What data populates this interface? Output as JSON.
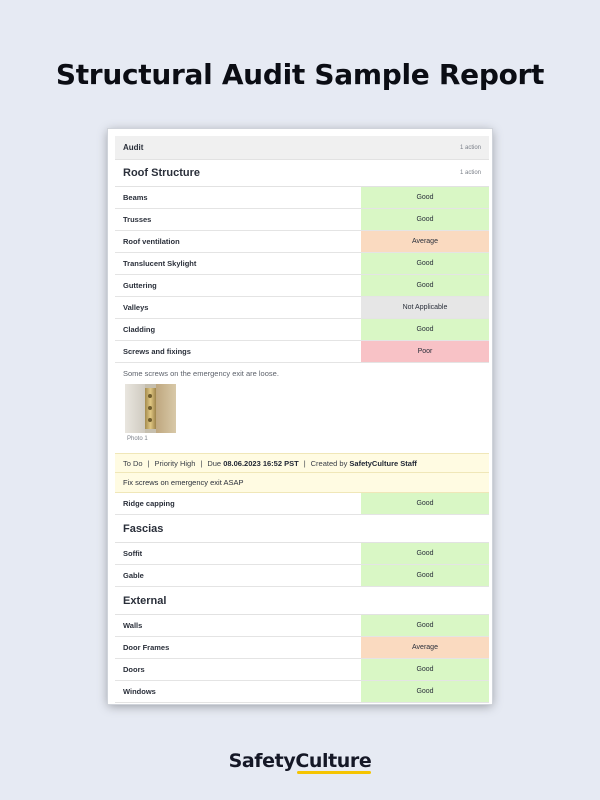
{
  "page": {
    "title": "Structural Audit Sample Report"
  },
  "report": {
    "audit": {
      "label": "Audit",
      "count": "1 action"
    },
    "sections": [
      {
        "title": "Roof Structure",
        "count": "1 action",
        "rows": [
          {
            "label": "Beams",
            "response": "Good",
            "status": "good"
          },
          {
            "label": "Trusses",
            "response": "Good",
            "status": "good"
          },
          {
            "label": "Roof ventilation",
            "response": "Average",
            "status": "average"
          },
          {
            "label": "Translucent Skylight",
            "response": "Good",
            "status": "good"
          },
          {
            "label": "Guttering",
            "response": "Good",
            "status": "good"
          },
          {
            "label": "Valleys",
            "response": "Not Applicable",
            "status": "na"
          },
          {
            "label": "Cladding",
            "response": "Good",
            "status": "good"
          },
          {
            "label": "Screws and fixings",
            "response": "Poor",
            "status": "poor"
          }
        ],
        "note": {
          "text": "Some screws on the emergency exit are loose.",
          "photo_caption": "Photo 1"
        },
        "action": {
          "status": "To Do",
          "priority": "Priority High",
          "due_prefix": "Due",
          "due_date": "08.06.2023 16:52 PST",
          "created_prefix": "Created by",
          "created_by": "SafetyCulture Staff",
          "title": "Fix screws on emergency exit ASAP"
        },
        "extra_row": {
          "label": "Ridge capping",
          "response": "Good",
          "status": "good"
        }
      },
      {
        "title": "Fascias",
        "rows": [
          {
            "label": "Soffit",
            "response": "Good",
            "status": "good"
          },
          {
            "label": "Gable",
            "response": "Good",
            "status": "good"
          }
        ]
      },
      {
        "title": "External",
        "rows": [
          {
            "label": "Walls",
            "response": "Good",
            "status": "good"
          },
          {
            "label": "Door Frames",
            "response": "Average",
            "status": "average"
          },
          {
            "label": "Doors",
            "response": "Good",
            "status": "good"
          },
          {
            "label": "Windows",
            "response": "Good",
            "status": "good"
          }
        ]
      }
    ]
  },
  "brand": {
    "part1": "Safety",
    "part2": "Culture"
  },
  "colors": {
    "good": "#d9f7c5",
    "average": "#fadac0",
    "not_applicable": "#e6e6e6",
    "poor": "#f8c2c6",
    "action_bg": "#fffbe2",
    "brand_accent": "#f5c400"
  }
}
